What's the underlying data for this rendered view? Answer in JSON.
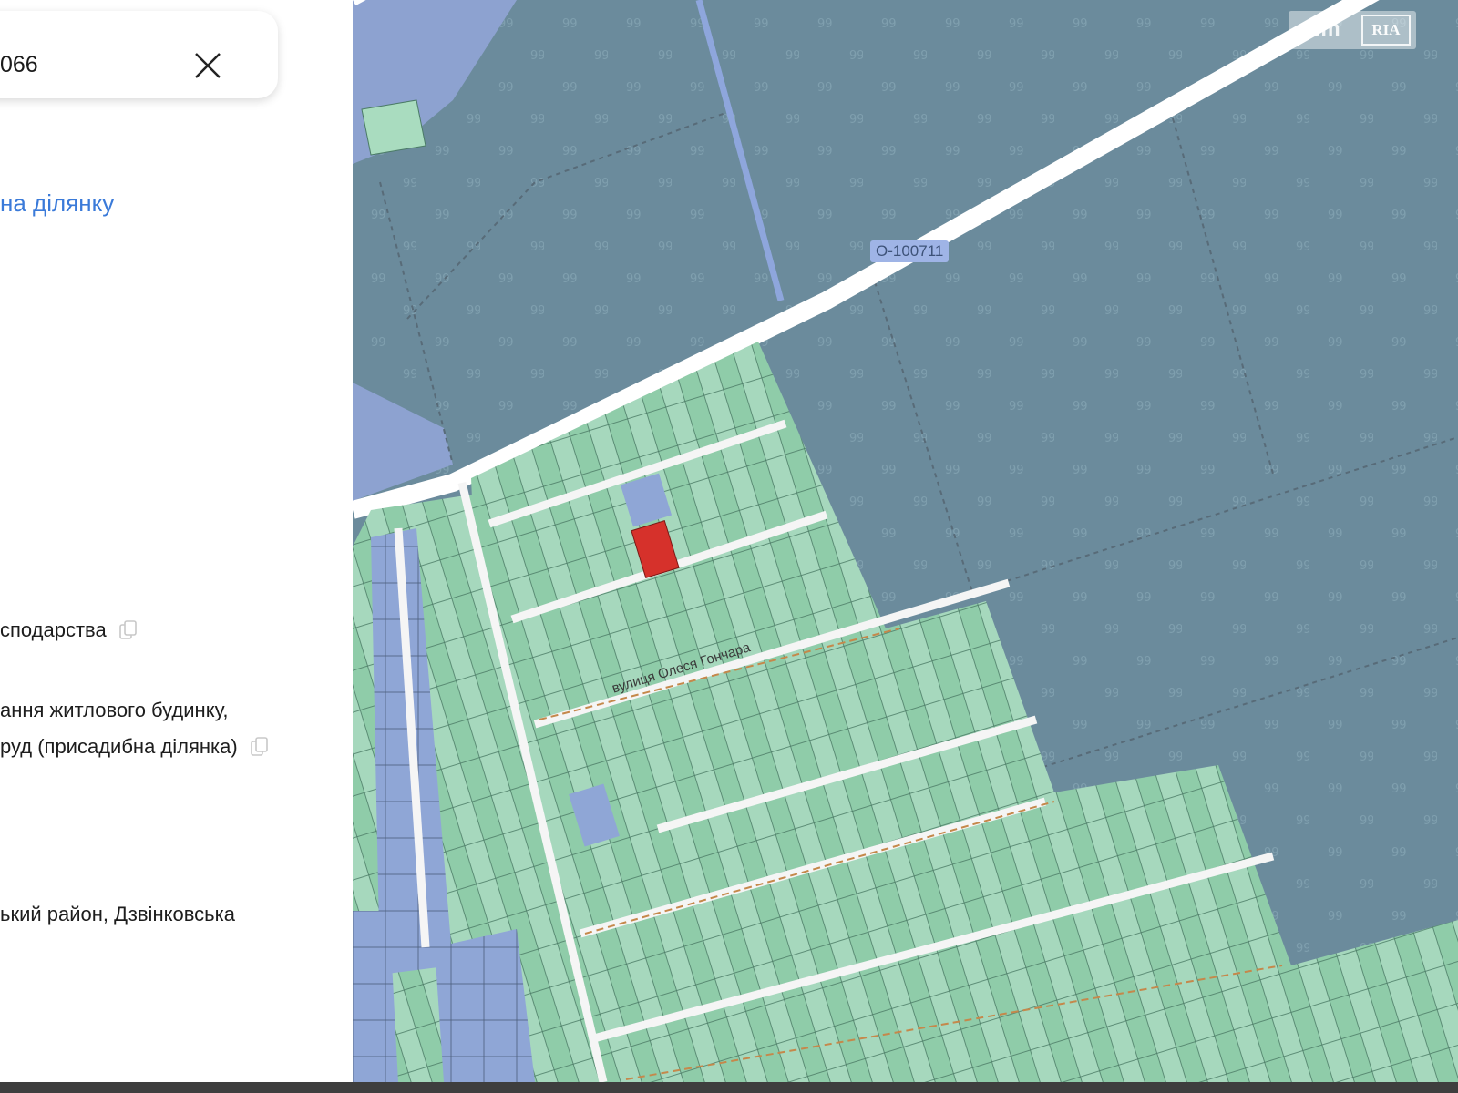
{
  "search": {
    "value": "066"
  },
  "icons": {
    "close": "close-icon",
    "copy": "copy-icon"
  },
  "sidebar": {
    "parcel_link": "на ділянку",
    "info": [
      {
        "lines": [
          "сподарства"
        ],
        "copy": true
      },
      {
        "lines": [
          "ання житлового будинку,",
          "руд (присадибна ділянка)"
        ],
        "copy": true
      },
      {
        "lines": [
          "ький район, Дзвінковська"
        ],
        "copy": false
      }
    ]
  },
  "map": {
    "road_badge": "O-100711",
    "street_label": "вулиця Олеся Гончара",
    "watermark_left": "dim",
    "watermark_right": "RIA",
    "colors": {
      "forest": "#6b8b9c",
      "parcel_green": "#9fd4b8",
      "parcel_green_dark": "#66bb8f",
      "parcel_blue": "#8a9fd0",
      "selected_parcel": "#d6312b",
      "road": "#f3f3f3"
    }
  }
}
